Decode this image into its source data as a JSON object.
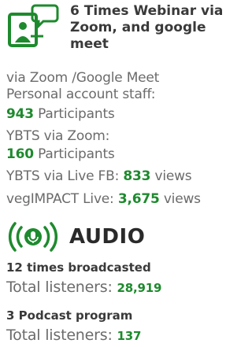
{
  "colors": {
    "accent": "#1e8a2e",
    "text": "#6b6b6b",
    "heading": "#3a3a3a"
  },
  "webinar": {
    "icon": "presenter-chat-icon",
    "title": "6 Times Webinar via Zoom, and google meet",
    "line1": "via Zoom /Google Meet",
    "line2": "Personal account staff:",
    "personal_count": "943",
    "participants_label": "Participants",
    "line4": "YBTS via Zoom:",
    "ybts_zoom_count": "160",
    "line6_label": "YBTS via Live FB:",
    "ybts_fb_count": "833",
    "views_label": "views",
    "line7_label": "vegIMPACT Live:",
    "vegimpact_count": "3,675"
  },
  "audio": {
    "icon": "broadcast-microphone-icon",
    "title": "AUDIO",
    "broadcast_label": "12 times broadcasted",
    "listeners_label": "Total listeners:",
    "broadcast_listeners": "28,919",
    "podcast_label": "3 Podcast program",
    "podcast_listeners": "137"
  }
}
